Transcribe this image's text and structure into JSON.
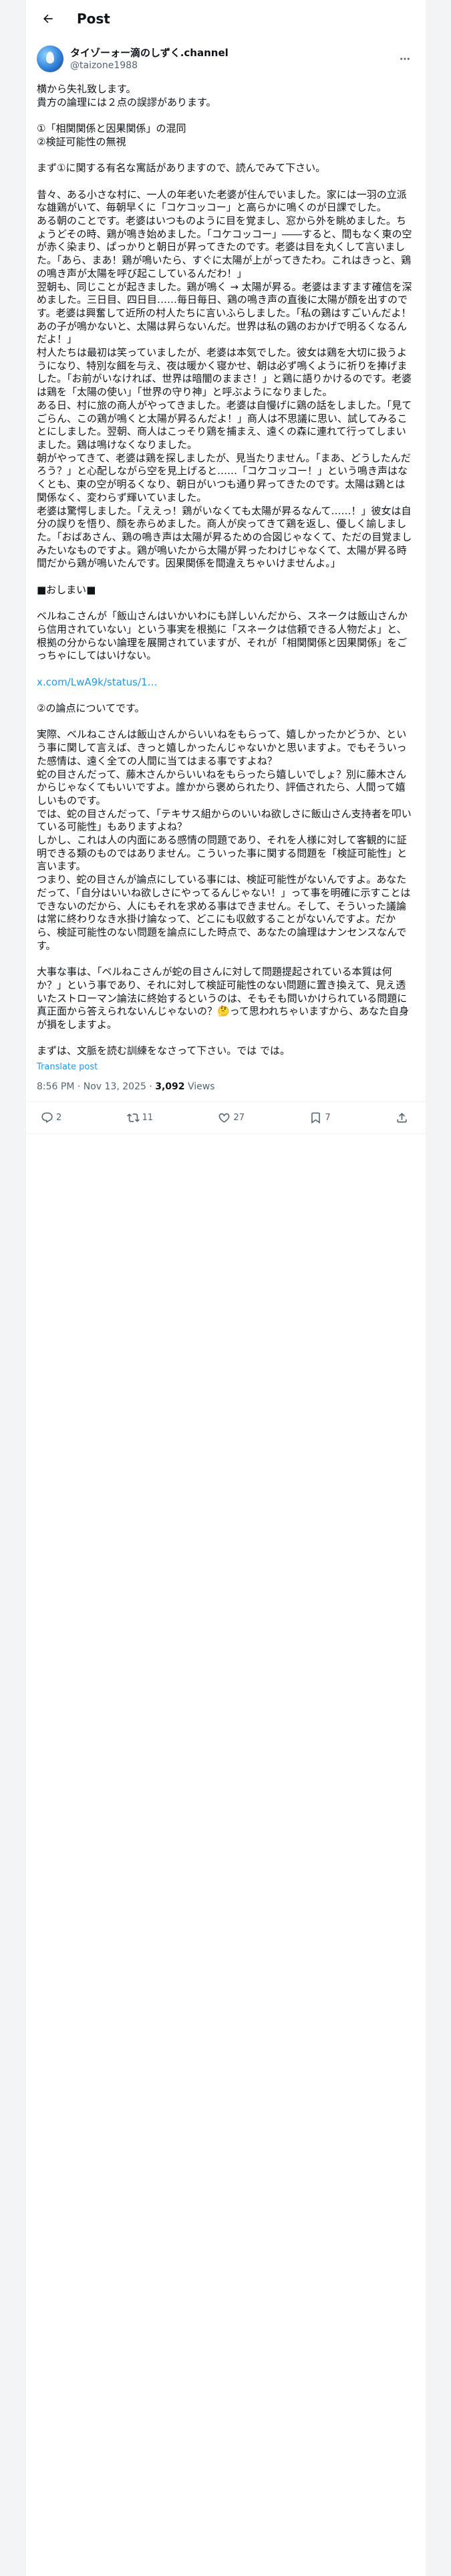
{
  "header": {
    "title": "Post"
  },
  "author": {
    "display_name": "タイゾーォー滴のしずく.channel",
    "handle": "@taizone1988"
  },
  "post": {
    "text": "横から失礼致します。\n貴方の論理には２点の誤謬があります。\n\n①「相関関係と因果関係」の混同\n②検証可能性の無視\n\nまず①に関する有名な寓話がありますので、読んでみて下さい。\n\n昔々、ある小さな村に、一人の年老いた老婆が住んでいました。家には一羽の立派な雄鶏がいて、毎朝早くに「コケコッコー」と高らかに鳴くのが日課でした。\nある朝のことです。老婆はいつものように目を覚まし、窓から外を眺めました。ちょうどその時、鶏が鳴き始めました。「コケコッコー」――すると、間もなく東の空が赤く染まり、ぱっかりと朝日が昇ってきたのです。老婆は目を丸くして言いました。「あら、まあ！鶏が鳴いたら、すぐに太陽が上がってきたわ。これはきっと、鶏の鳴き声が太陽を呼び起こしているんだわ！」\n翌朝も、同じことが起きました。鶏が鳴く → 太陽が昇る。老婆はますます確信を深めました。三日目、四日目……毎日毎日、鶏の鳴き声の直後に太陽が顔を出すのです。老婆は興奮して近所の村人たちに言いふらしました。「私の鶏はすごいんだよ！あの子が鳴かないと、太陽は昇らないんだ。世界は私の鶏のおかげで明るくなるんだよ！」\n村人たちは最初は笑っていましたが、老婆は本気でした。彼女は鶏を大切に扱うようになり、特別な餌を与え、夜は暖かく寝かせ、朝は必ず鳴くように祈りを捧げました。「お前がいなければ、世界は暗闇のままさ！」と鶏に語りかけるのです。老婆は鶏を「太陽の使い」「世界の守り神」と呼ぶようになりました。\nある日、村に旅の商人がやってきました。老婆は自慢げに鶏の話をしました。「見てごらん、この鶏が鳴くと太陽が昇るんだよ！」商人は不思議に思い、試してみることにしました。翌朝、商人はこっそり鶏を捕まえ、遠くの森に連れて行ってしまいました。鶏は鳴けなくなりました。\n朝がやってきて、老婆は鶏を探しましたが、見当たりません。「まあ、どうしたんだろう？」と心配しながら空を見上げると……「コケコッコー！」という鳴き声はなくとも、東の空が明るくなり、朝日がいつも通り昇ってきたのです。太陽は鶏とは関係なく、変わらず輝いていました。\n老婆は驚愕しました。「ええっ！鶏がいなくても太陽が昇るなんて……！」彼女は自分の誤りを悟り、顔を赤らめました。商人が戻ってきて鶏を返し、優しく諭しました。「おばあさん、鶏の鳴き声は太陽が昇るための合図じゃなくて、ただの目覚ましみたいなものですよ。鶏が鳴いたから太陽が昇ったわけじゃなくて、太陽が昇る時間だから鶏が鳴いたんです。因果関係を間違えちゃいけませんよ。」\n\n■おしまい■\n\nベルねこさんが「飯山さんはいかいわにも詳しいんだから、スネークは飯山さんから信用されていない」という事実を根拠に「スネークは信頼できる人物だよ」と、根拠の分からない論理を展開されていますが、それが「相関関係と因果関係」をごっちゃにしてはいけない。\n\nx.com/LwA9k/status/1…\n\n②の論点についてです。\n\n実際、ベルねこさんは飯山さんからいいねをもらって、嬉しかったかどうか、という事に関して言えば、きっと嬉しかったんじゃないかと思いますよ。でもそういった感情は、遠く全ての人間に当てはまる事ですよね？\n蛇の目さんだって、藤木さんからいいねをもらったら嬉しいでしょ？別に藤木さんからじゃなくてもいいですよ。誰かから褒められたり、評価されたら、人間って嬉しいものです。\nでは、蛇の目さんだって、「テキサス組からのいいね欲しさに飯山さん支持者を叩いている可能性」もありますよね？\nしかし、これは人の内面にある感情の問題であり、それを人様に対して客観的に証明できる類のものではありません。こういった事に関する問題を「検証可能性」と言います。\nつまり、蛇の目さんが論点にしている事には、検証可能性がないんですよ。あなただって、「自分はいいね欲しさにやってるんじゃない！」って事を明確に示すことはできないのだから、人にもそれを求める事はできません。そして、そういった議論は常に終わりなき水掛け論なって、どこにも収斂することがないんですよ。だから、検証可能性のない問題を論点にした時点で、あなたの論理はナンセンスなんです。\n\n大事な事は、「ベルねこさんが蛇の目さんに対して問題提起されている本質は何か？」という事であり、それに対して検証可能性のない問題に置き換えて、見え透いたストローマン論法に終始するというのは、そもそも問いかけられている問題に真正面から答えられないんじゃないの？🤔って思われちゃいますから、あなた自身が損をしますよ。\n\nまずは、文脈を読む訓練をなさって下さい。では では。",
    "link_text": "x.com/LwA9k/status/1…",
    "translate": "Translate post",
    "time": "8:56 PM · Nov 13, 2025",
    "views": "3,092",
    "views_label": "Views"
  },
  "actions": {
    "replies": "2",
    "reposts": "11",
    "likes": "27",
    "bookmarks": "7"
  },
  "colors": {
    "link": "#1d9bf0",
    "secondary_text": "#536471"
  }
}
